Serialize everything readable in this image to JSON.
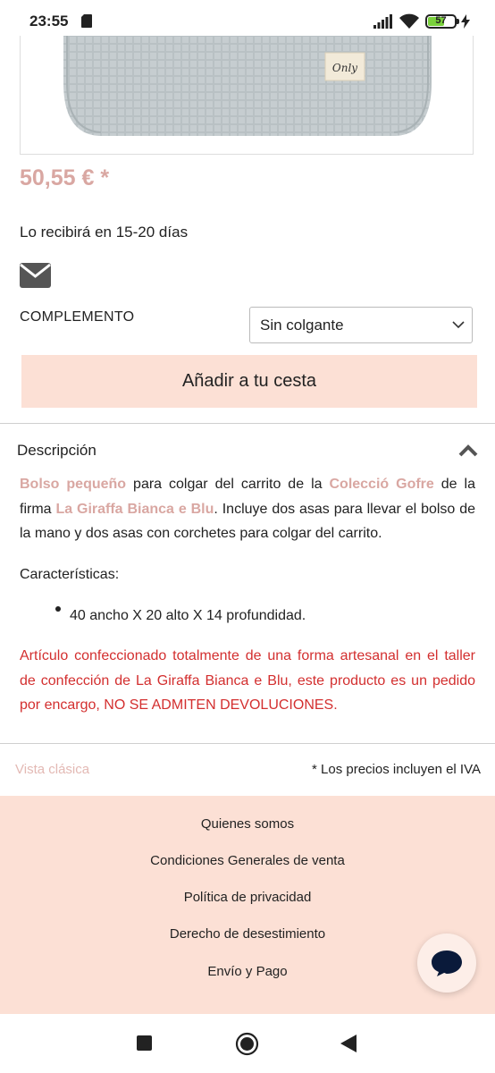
{
  "status": {
    "time": "23:55",
    "battery": "57"
  },
  "product": {
    "tag_text": "Only",
    "price": "50,55 € *",
    "delivery": "Lo recibirá en 15-20 días",
    "option_label": "COMPLEMENTO",
    "option_value": "Sin colgante",
    "add_to_cart": "Añadir a tu cesta"
  },
  "description": {
    "title": "Descripción",
    "p1": {
      "link1": "Bolso pequeño",
      "t1": " para colgar del carrito de la ",
      "link2": "Colecció Gofre",
      "t2": " de la firma ",
      "link3": "La Giraffa Bianca e Blu",
      "t3": ". Incluye dos asas para llevar el bolso de la mano y dos asas con corchetes para colgar del carrito."
    },
    "features_label": "Características:",
    "feature1": "40 ancho X 20 alto X 14 profundidad.",
    "notice": "Artículo confeccionado totalmente de una forma artesanal en el taller de confección de La Giraffa Bianca e Blu, este producto es un pedido por encargo, NO SE ADMITEN DEVOLUCIONES."
  },
  "footer": {
    "classic_view": "Vista clásica",
    "vat_note": "* Los precios incluyen el IVA",
    "links": [
      "Quienes somos",
      "Condiciones Generales de venta",
      "Política de privacidad",
      "Derecho de desestimiento",
      "Envío y Pago"
    ]
  },
  "colors": {
    "accent_pink": "#d9a7a2",
    "button_bg": "#fce0d5",
    "alert_red": "#d32f2f"
  }
}
